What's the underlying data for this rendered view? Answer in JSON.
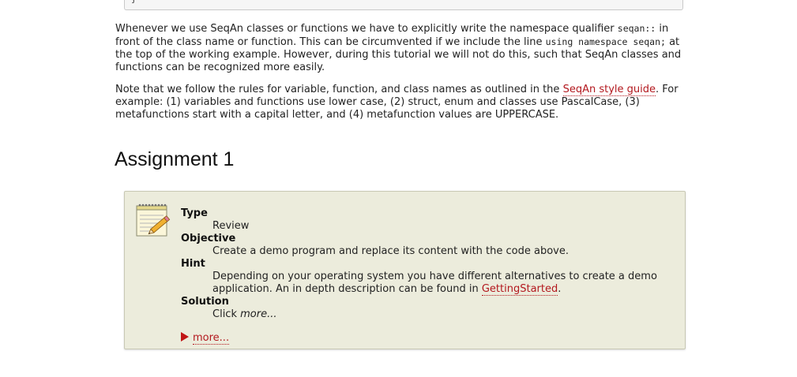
{
  "code_tail": "}",
  "para1": {
    "t1": "Whenever we use SeqAn classes or functions we have to explicitly write the namespace qualifier ",
    "c1": "seqan::",
    "t2": " in front of the class name or function. This can be circumvented if we include the line ",
    "c2": "using namespace seqan;",
    "t3": " at the top of the working example. However, during this tutorial we will not do this, such that SeqAn classes and functions can be recognized more easily."
  },
  "para2": {
    "t1": "Note that we follow the rules for variable, function, and class names as outlined in the ",
    "link": "SeqAn style guide",
    "t2": ". For example: (1) variables and functions use lower case, (2) struct, enum and classes use PascalCase, (3) metafunctions start with a capital letter, and (4) metafunction values are UPPERCASE."
  },
  "heading": "Assignment 1",
  "assignment": {
    "type_label": "Type",
    "type_value": "Review",
    "objective_label": "Objective",
    "objective_value": "Create a demo program and replace its content with the code above.",
    "hint_label": "Hint",
    "hint_text": "Depending on your operating system you have different alternatives to create a demo application. An in depth description can be found in ",
    "hint_link": "GettingStarted",
    "hint_end": ".",
    "solution_label": "Solution",
    "solution_text": "Click ",
    "solution_em": "more...",
    "more_label": "more..."
  },
  "colors": {
    "link": "#b3181e",
    "box_bg": "#ececdc",
    "triangle": "#c11616"
  },
  "icons": {
    "note": "notepad-pencil-icon",
    "toggle": "triangle-right-icon"
  }
}
